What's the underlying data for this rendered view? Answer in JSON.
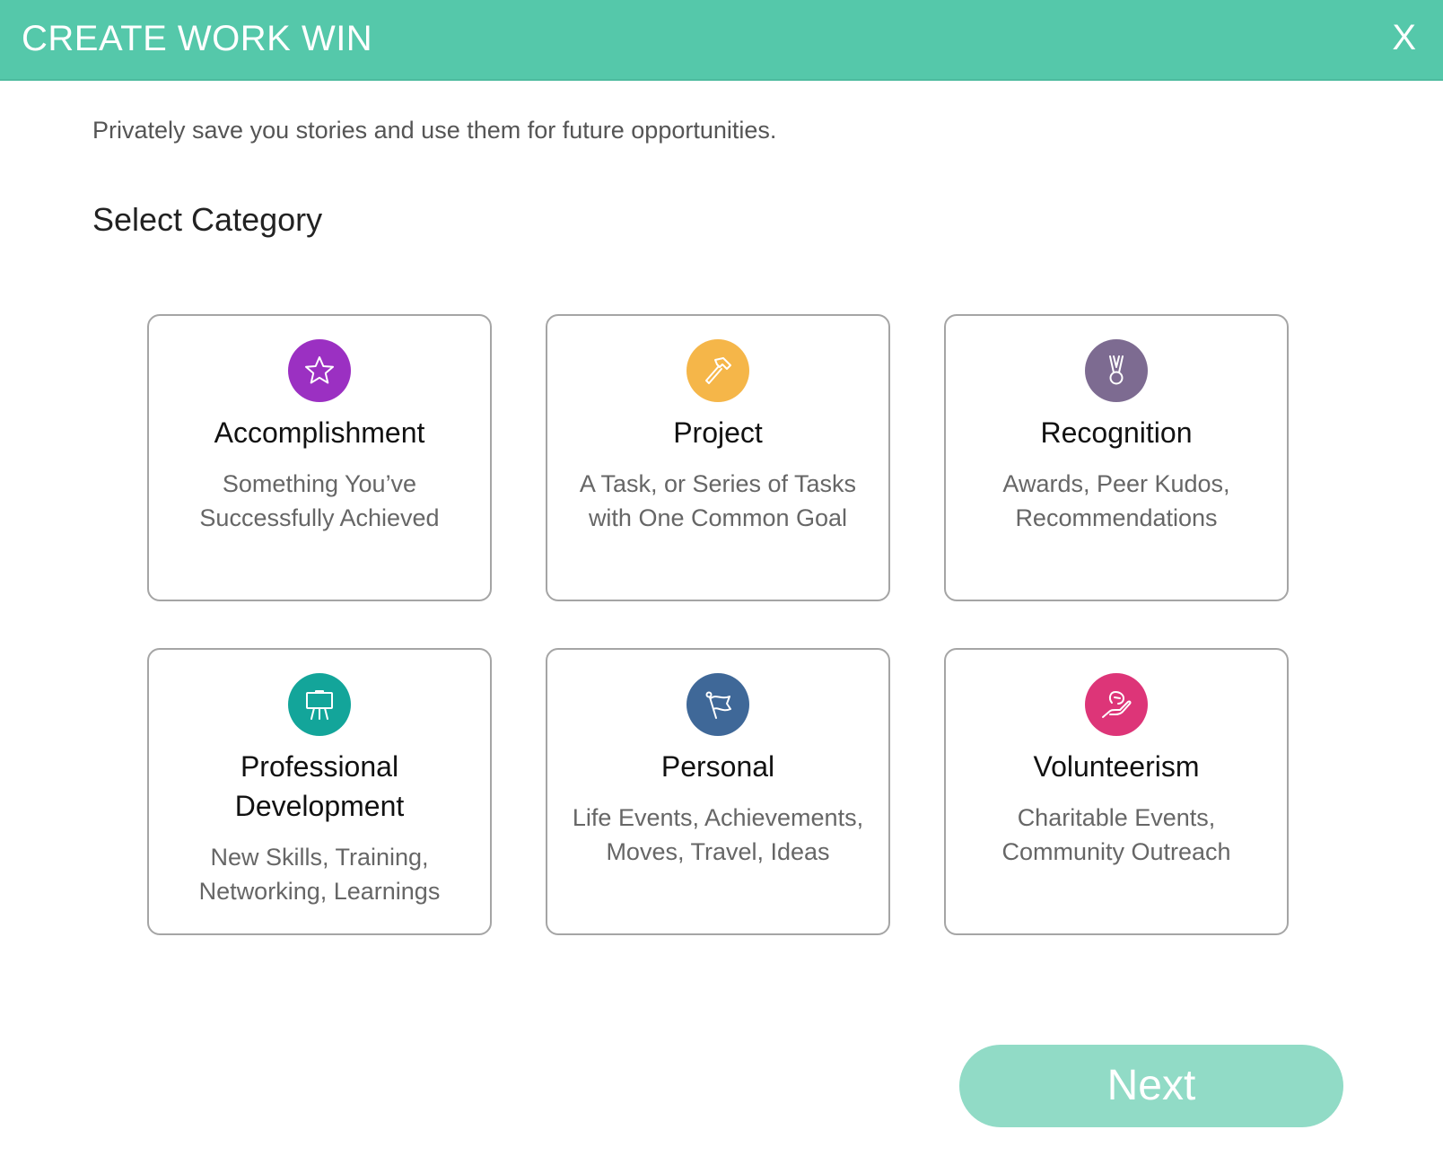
{
  "header": {
    "title": "CREATE WORK WIN",
    "close_label": "X",
    "background": "#55c8aa"
  },
  "main": {
    "subtitle": "Privately save you stories and use them for future opportunities.",
    "section_title": "Select Category",
    "categories": [
      {
        "title": "Accomplishment",
        "description": "Something You’ve Successfully Achieved",
        "icon": "star-icon",
        "color": "#9b30c2"
      },
      {
        "title": "Project",
        "description": "A Task, or Series of Tasks with One Common Goal",
        "icon": "hammer-icon",
        "color": "#f5b649"
      },
      {
        "title": "Recognition",
        "description": "Awards, Peer Kudos, Recommendations",
        "icon": "medal-icon",
        "color": "#7d6b91"
      },
      {
        "title": "Professional Development",
        "description": "New Skills, Training, Networking, Learnings",
        "icon": "presentation-easel-icon",
        "color": "#13a59a"
      },
      {
        "title": "Personal",
        "description": "Life Events, Achievements, Moves, Travel, Ideas",
        "icon": "flag-icon",
        "color": "#3f6898"
      },
      {
        "title": "Volunteerism",
        "description": "Charitable Events, Community Outreach",
        "icon": "helping-hand-icon",
        "color": "#dd3578"
      }
    ]
  },
  "footer": {
    "next_label": "Next",
    "next_color": "#91dbc6"
  }
}
